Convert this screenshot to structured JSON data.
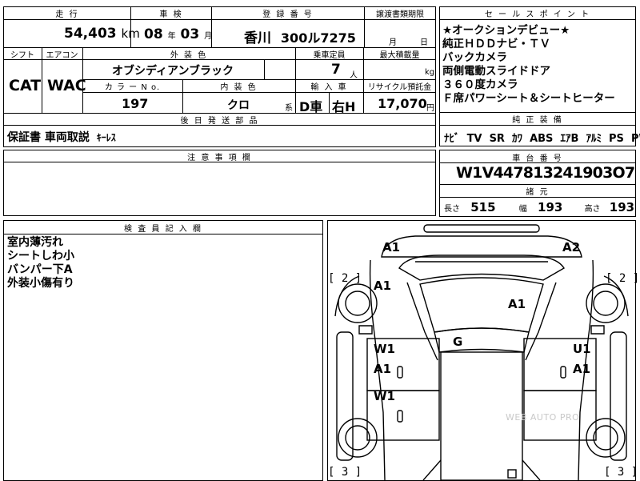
{
  "header": {
    "mileage_label": "走 行",
    "inspection_label": "車 検",
    "registration_label": "登 録 番 号",
    "transfer_label": "譲渡書類期限",
    "sales_point_label": "セ ー ル ス ポ イ ン ト"
  },
  "mileage": {
    "value": "54,403",
    "unit": "km"
  },
  "inspection": {
    "year": "08",
    "year_unit": "年",
    "month": "03",
    "month_unit": "月"
  },
  "registration": {
    "region": "香川",
    "number": "300ル7275"
  },
  "transfer": {
    "month_unit": "月",
    "day_unit": "日"
  },
  "specs": {
    "shift_label": "シフト",
    "aircon_label": "エアコン",
    "exterior_color_label": "外 装 色",
    "capacity_label": "乗車定員",
    "max_load_label": "最大積載量",
    "shift": "CAT",
    "aircon": "WAC",
    "exterior_color": "オブシディアンブラック",
    "capacity": "7",
    "capacity_unit": "人",
    "load_unit": "kg",
    "color_no_label": "カ ラ ー N o.",
    "interior_color_label": "内 装 色",
    "import_label": "輸 入 車",
    "recycle_label": "リサイクル預託金",
    "color_no": "197",
    "interior_color": "クロ",
    "interior_color_suffix": "系",
    "import_type": "D車",
    "steering": "右H",
    "recycle_fee": "17,070",
    "recycle_unit": "円"
  },
  "sales_points": [
    "★オークションデビュー★",
    "純正ＨＤＤナビ・ＴＶ",
    "バックカメラ",
    "両側電動スライドドア",
    "３６０度カメラ",
    "Ｆ席パワーシート＆シートヒーター"
  ],
  "genuine": {
    "label": "純 正 装 備",
    "items": [
      "ﾅﾋﾞ",
      "TV",
      "SR",
      "ｶﾜ",
      "ABS",
      "ｴｱB",
      "ｱﾙﾐ",
      "PS",
      "PW"
    ]
  },
  "delivery": {
    "label": "後 日 発 送 部 品",
    "items": "保証書 車両取説",
    "keyless": "ｷｰﾚｽ"
  },
  "notes_label": "注 意 事 項 欄",
  "chassis": {
    "label": "車 台 番 号",
    "number": "W1V447813241903O7"
  },
  "dimensions": {
    "label": "諸 元",
    "length_label": "長さ",
    "length": "515",
    "width_label": "幅",
    "width": "193",
    "height_label": "高さ",
    "height": "193"
  },
  "inspector": {
    "label": "検 査 員 記 入 欄",
    "notes": [
      "室内薄汚れ",
      "シートしわ小",
      "バンパー下A",
      "外装小傷有り"
    ]
  },
  "damage": {
    "front_left": "A1",
    "front_right": "A2",
    "hood_left": "A1",
    "windshield": "A1",
    "roof": "G",
    "left_front_door_1": "W1",
    "left_front_door_2": "A1",
    "left_rear_door": "W1",
    "right_front_door_1": "U1",
    "right_front_door_2": "A1",
    "bracket_left_top": "[ 2 ]",
    "bracket_right_top": "[ 2 ]",
    "bracket_left_bottom": "[ 3 ]",
    "bracket_right_bottom": "[ 3 ]"
  },
  "watermark": "WEB AUTO PRO"
}
